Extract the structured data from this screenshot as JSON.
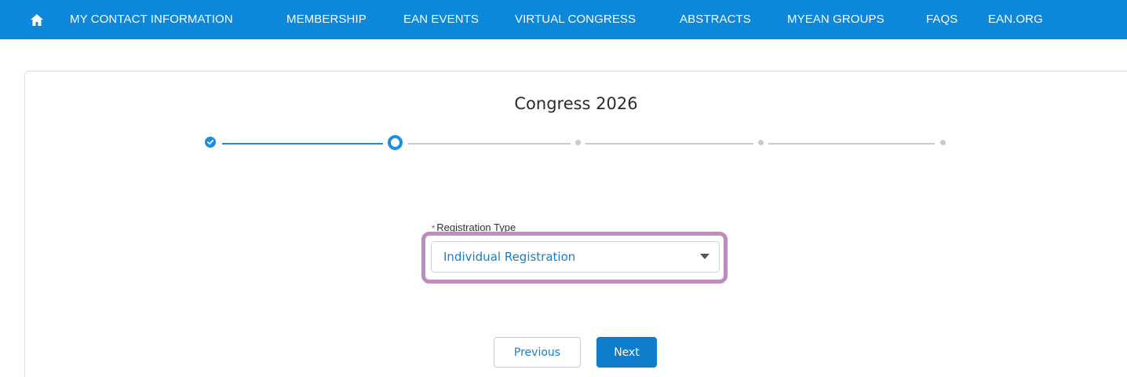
{
  "nav": {
    "home_icon": "home-icon",
    "links": [
      "MY CONTACT INFORMATION",
      "MEMBERSHIP",
      "EAN EVENTS",
      "VIRTUAL CONGRESS",
      "ABSTRACTS",
      "MYEAN GROUPS",
      "FAQS",
      "EAN.ORG"
    ]
  },
  "page": {
    "title": "Congress 2026"
  },
  "progress": {
    "total_steps": 5,
    "completed_steps": 1,
    "current_step": 2
  },
  "form": {
    "registration_type": {
      "required_marker": "*",
      "label": "Registration Type",
      "value": "Individual Registration"
    }
  },
  "buttons": {
    "previous": "Previous",
    "next": "Next"
  },
  "colors": {
    "nav_bg": "#0d87d9",
    "accent": "#1a8fdd",
    "highlight": "#c08bbf",
    "required": "#c23934"
  }
}
